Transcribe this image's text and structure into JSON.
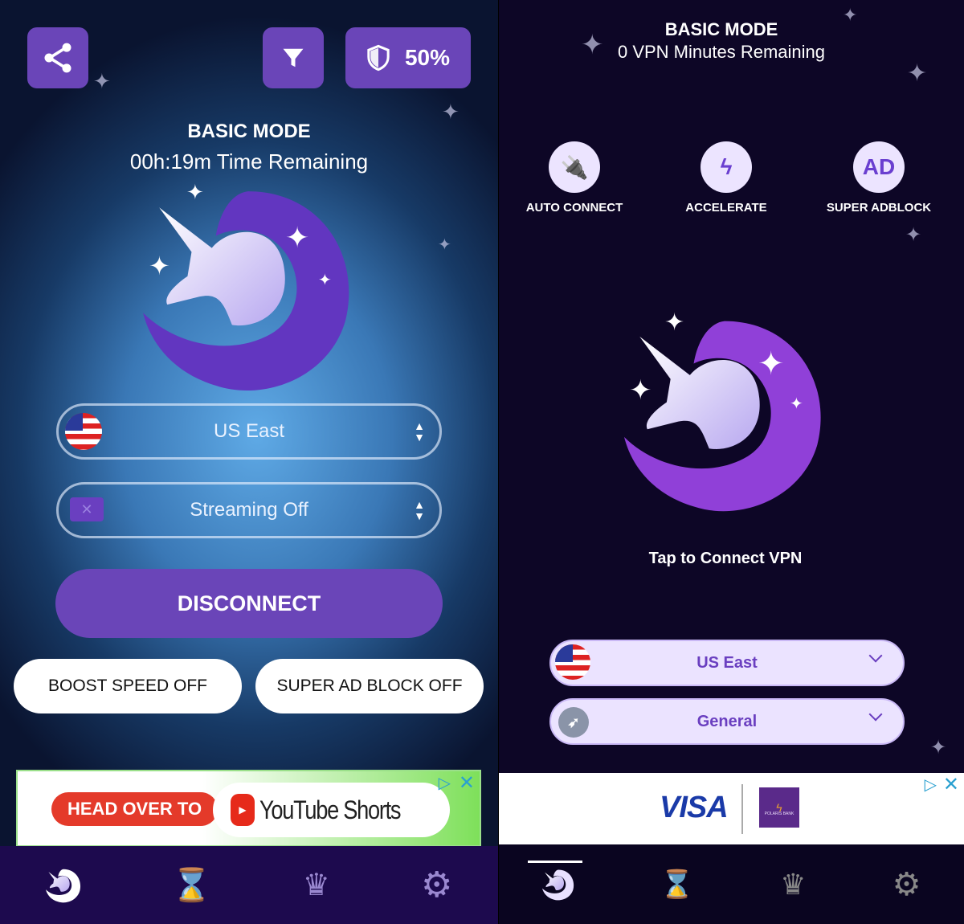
{
  "left": {
    "top_buttons": {
      "share_icon": "share-icon",
      "filter_icon": "filter-icon",
      "shield_percent": "50%"
    },
    "mode_title": "BASIC MODE",
    "time_remaining": "00h:19m Time Remaining",
    "location_select": {
      "value": "US East",
      "icon": "us-flag"
    },
    "streaming_select": {
      "value": "Streaming Off",
      "icon": "tv-off-icon"
    },
    "disconnect_label": "DISCONNECT",
    "boost_speed_label": "BOOST SPEED OFF",
    "super_ad_block_label": "SUPER AD BLOCK OFF",
    "ad": {
      "tag": "HEAD OVER TO",
      "brand": "YouTube Shorts"
    },
    "nav": [
      "unicorn-icon",
      "hourglass-icon",
      "crown-icon",
      "gear-icon"
    ]
  },
  "right": {
    "mode_title": "BASIC MODE",
    "minutes_remaining": "0 VPN Minutes Remaining",
    "features": [
      {
        "label": "AUTO CONNECT",
        "icon": "plug-icon"
      },
      {
        "label": "ACCELERATE",
        "icon": "lightning-off-icon"
      },
      {
        "label": "SUPER ADBLOCK",
        "icon_text": "AD"
      }
    ],
    "connect_prompt": "Tap to Connect VPN",
    "location_select": {
      "value": "US East"
    },
    "protocol_select": {
      "value": "General",
      "icon": "rocket-icon"
    },
    "ad": {
      "brand1": "VISA",
      "brand2": "POLARIS BANK"
    },
    "nav": [
      "unicorn-icon",
      "hourglass-icon",
      "crown-icon",
      "gear-icon"
    ]
  },
  "colors": {
    "accent": "#6a45b8",
    "nav_left": "#1d0a4e",
    "nav_right": "#0a0520"
  }
}
